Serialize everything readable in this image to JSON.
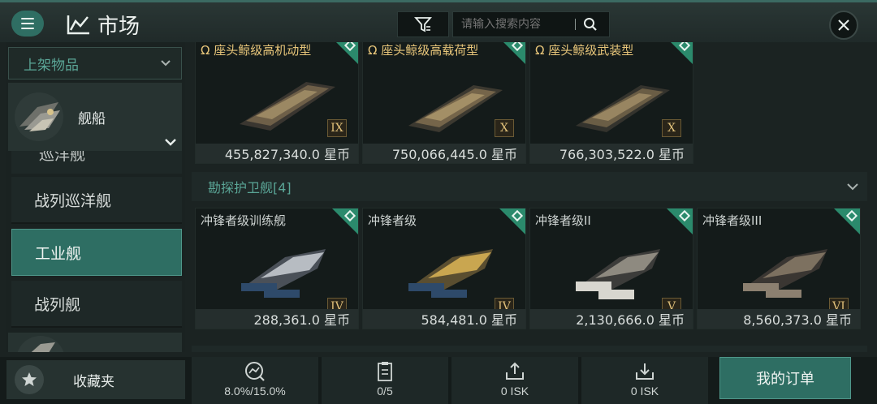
{
  "header": {
    "title": "市场",
    "search_placeholder": "请输入搜索内容"
  },
  "sidebar": {
    "dropdown_label": "上架物品",
    "category_label": "舰船",
    "partial_item": "巡洋舰",
    "items": [
      {
        "label": "战列巡洋舰",
        "selected": false
      },
      {
        "label": "工业舰",
        "selected": true
      },
      {
        "label": "战列舰",
        "selected": false
      }
    ],
    "favorites_label": "收藏夹"
  },
  "main": {
    "top_cards": [
      {
        "name": "Ω 座头鲸级高机动型",
        "tier": "IX",
        "price": "455,827,340.0 星币"
      },
      {
        "name": "Ω 座头鲸级高载荷型",
        "tier": "X",
        "price": "750,066,445.0 星币"
      },
      {
        "name": "Ω 座头鲸级武装型",
        "tier": "X",
        "price": "766,303,522.0 星币"
      }
    ],
    "group_title": "勘探护卫舰[4]",
    "group_cards": [
      {
        "name": "冲锋者级训练舰",
        "tier": "IV",
        "price": "288,361.0 星币"
      },
      {
        "name": "冲锋者级",
        "tier": "IV",
        "price": "584,481.0 星币"
      },
      {
        "name": "冲锋者级II",
        "tier": "V",
        "price": "2,130,666.0 星币"
      },
      {
        "name": "冲锋者级III",
        "tier": "VI",
        "price": "8,560,373.0 星币"
      }
    ]
  },
  "bottom": {
    "tax_rate": "8.0%/15.0%",
    "orders_count": "0/5",
    "sell_isk": "0 ISK",
    "buy_isk": "0 ISK",
    "my_orders_label": "我的订单"
  },
  "colors": {
    "accent": "#2e6e63",
    "gold_text": "#e8c67a",
    "teal_text": "#5aa596"
  }
}
